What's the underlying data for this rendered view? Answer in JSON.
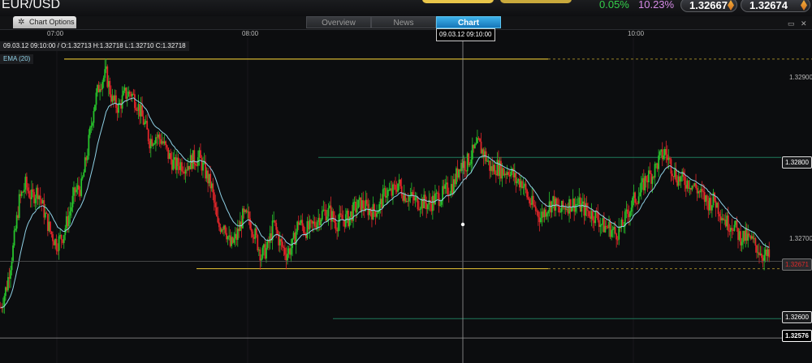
{
  "header": {
    "symbol": "EUR/USD",
    "change_percent": "0.05%",
    "alt_percent": "10.23%",
    "sell_price": "1.32667",
    "buy_price": "1.32674"
  },
  "toolbar": {
    "chart_options_label": "Chart Options",
    "tabs": [
      {
        "label": "Overview",
        "active": false
      },
      {
        "label": "News",
        "active": false
      },
      {
        "label": "Chart",
        "active": true
      }
    ]
  },
  "info": {
    "ohlc_text": "09.03.12 09:10:00 / O:1.32713 H:1.32718 L:1.32710 C:1.32718",
    "indicator_label": "EMA (20)"
  },
  "crosshair": {
    "time_label": "09.03.12 09:10:00",
    "price_label": "1.32576"
  },
  "colors": {
    "up": "#27c22b",
    "down": "#e0262a",
    "ema": "#8fd1e6",
    "support_line": "#d2b331",
    "guide_line": "#1f7a5a",
    "accent": "#1e8fd6"
  },
  "chart_data": {
    "type": "candlestick",
    "x_ticks": [
      "07:00",
      "08:00",
      "10:00"
    ],
    "y_ticks": [
      1.329,
      1.327
    ],
    "ylim": [
      1.32545,
      1.32945
    ],
    "price_labels": [
      {
        "value": "1.32800",
        "price": 1.328,
        "style": "boxed"
      },
      {
        "value": "1.32600",
        "price": 1.326,
        "style": "boxed"
      },
      {
        "value": "1.32576",
        "price": 1.32576,
        "style": "boxed"
      },
      {
        "value": "1.32671",
        "price": 1.32671,
        "style": "current"
      }
    ],
    "horizontal_levels": [
      {
        "price": 1.32922,
        "x_start_fraction": 0.079,
        "solid_until_fraction": 0.675,
        "kind": "resistance"
      },
      {
        "price": 1.32662,
        "x_start_fraction": 0.242,
        "solid_until_fraction": 0.675,
        "kind": "support"
      },
      {
        "price": 1.328,
        "x_start_fraction": 0.392,
        "kind": "guide"
      },
      {
        "price": 1.326,
        "x_start_fraction": 0.41,
        "kind": "guide"
      }
    ],
    "indicator": {
      "name": "EMA (20)"
    },
    "closes": [
      1.32614,
      1.32641,
      1.32687,
      1.32746,
      1.32766,
      1.3275,
      1.32759,
      1.32733,
      1.32708,
      1.32693,
      1.32703,
      1.32728,
      1.32758,
      1.32763,
      1.32808,
      1.32863,
      1.32893,
      1.32903,
      1.3287,
      1.32862,
      1.32878,
      1.3288,
      1.32867,
      1.32845,
      1.32821,
      1.32827,
      1.32821,
      1.32803,
      1.3279,
      1.32792,
      1.3279,
      1.32798,
      1.32799,
      1.32781,
      1.32762,
      1.32713,
      1.32719,
      1.3269,
      1.32701,
      1.32726,
      1.32725,
      1.32703,
      1.32678,
      1.32688,
      1.32718,
      1.32694,
      1.32681,
      1.3269,
      1.32721,
      1.3271,
      1.32712,
      1.32723,
      1.32732,
      1.32732,
      1.32718,
      1.32723,
      1.32724,
      1.32736,
      1.32742,
      1.32737,
      1.32733,
      1.32738,
      1.32758,
      1.32755,
      1.32768,
      1.32754,
      1.32751,
      1.32745,
      1.32745,
      1.32741,
      1.32749,
      1.32752,
      1.32761,
      1.32767,
      1.32793,
      1.32792,
      1.32805,
      1.32816,
      1.32803,
      1.32785,
      1.32789,
      1.32782,
      1.32785,
      1.32771,
      1.3277,
      1.32748,
      1.32737,
      1.32726,
      1.32738,
      1.32745,
      1.32732,
      1.3274,
      1.32743,
      1.32742,
      1.32736,
      1.32731,
      1.32727,
      1.32715,
      1.32713,
      1.32706,
      1.32712,
      1.32731,
      1.32747,
      1.32756,
      1.32775,
      1.32779,
      1.32796,
      1.32807,
      1.3279,
      1.32775,
      1.32771,
      1.32769,
      1.32762,
      1.32752,
      1.32744,
      1.32747,
      1.32732,
      1.32719,
      1.32717,
      1.32702,
      1.32701,
      1.32696,
      1.32687,
      1.32678,
      1.32675
    ]
  }
}
